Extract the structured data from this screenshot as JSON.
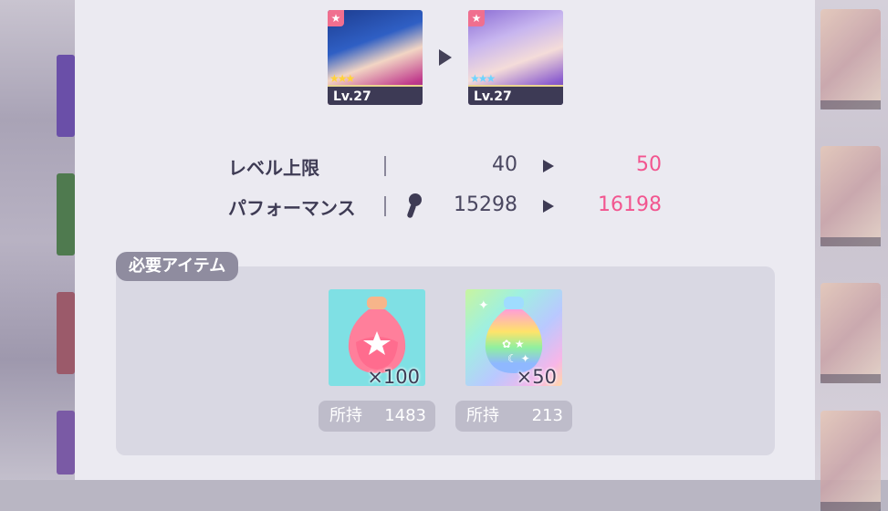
{
  "cards": {
    "before": {
      "level_label": "Lv.27",
      "stars": 3,
      "rarity_icon": "star-icon"
    },
    "after": {
      "level_label": "Lv.27",
      "stars": 3,
      "rarity_icon": "star-icon"
    }
  },
  "stats": {
    "level_cap": {
      "label": "レベル上限",
      "current": "40",
      "next": "50"
    },
    "performance": {
      "label": "パフォーマンス",
      "icon": "microphone-icon",
      "current": "15298",
      "next": "16198"
    }
  },
  "required_items": {
    "title": "必要アイテム",
    "items": [
      {
        "icon": "pink-star-bottle-icon",
        "quantity": "×100",
        "owned_label": "所持",
        "owned": "1483"
      },
      {
        "icon": "rainbow-bottle-icon",
        "quantity": "×50",
        "owned_label": "所持",
        "owned": "213"
      }
    ]
  },
  "colors": {
    "accent": "#f2558f",
    "panel": "#ebeaf1",
    "text": "#3e3b54"
  }
}
